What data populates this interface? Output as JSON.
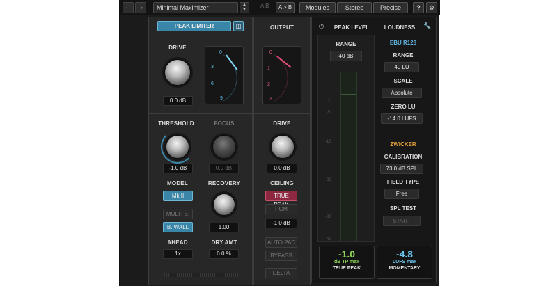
{
  "topbar": {
    "back_icon": "←",
    "forward_icon": "→",
    "preset_name": "Minimal Maximizer",
    "a_label": "A  B",
    "ab_label": "A > B",
    "modules_label": "Modules",
    "stereo_label": "Stereo",
    "precise_label": "Precise",
    "help_label": "?",
    "settings_icon": "⚙"
  },
  "limiter": {
    "header_label": "PEAK LIMITER",
    "drive_label": "DRIVE",
    "drive_value": "0.0 dB",
    "gr_scale": [
      "0",
      "3",
      "6",
      "9"
    ],
    "threshold_label": "THRESHOLD",
    "threshold_value": "-1.0 dB",
    "focus_label": "FOCUS",
    "focus_value": "0.0 dB",
    "model_label": "MODEL",
    "model_value": "Mk II",
    "recovery_label": "RECOVERY",
    "recovery_value": "1.00",
    "multi_b_label": "MULTI B.",
    "b_wall_label": "B. WALL",
    "ahead_label": "AHEAD",
    "ahead_value": "1x",
    "dry_amt_label": "DRY AMT",
    "dry_amt_value": "0.0 %"
  },
  "output": {
    "header_label": "OUTPUT",
    "scale": [
      "0",
      "1",
      "2",
      "3"
    ],
    "drive_label": "DRIVE",
    "drive_value": "0.0 dB",
    "ceiling_label": "CEILING",
    "true_peak_label": "TRUE PEAK",
    "pcm_label": "PCM",
    "ceiling_value": "-1.0 dB",
    "auto_pad_label": "AUTO PAD",
    "bypass_label": "BYPASS",
    "delta_label": "DELTA"
  },
  "meter": {
    "power_icon": "⏻",
    "peak_level_label": "PEAK LEVEL",
    "loudness_label": "LOUDNESS",
    "wrench_icon": "🔧",
    "range_label": "RANGE",
    "range_value": "40 dB",
    "ebu_label": "EBU R128",
    "loud_range_label": "RANGE",
    "loud_range_value": "40 LU",
    "scale_label": "SCALE",
    "scale_value": "Absolute",
    "zero_lu_label": "ZERO LU",
    "zero_lu_value": "-14.0 LUFS",
    "zwicker_label": "ZWICKER",
    "calibration_label": "CALIBRATION",
    "calibration_value": "73.0 dB SPL",
    "field_type_label": "FIELD TYPE",
    "field_type_value": "Free",
    "spl_test_label": "SPL TEST",
    "start_label": "START",
    "scale_marks": [
      "-1",
      "-5",
      "-10",
      "-20",
      "-30",
      "-40"
    ],
    "true_peak_value": "-1.0",
    "true_peak_unit": "dB TP max",
    "true_peak_caption": "TRUE PEAK",
    "momentary_value": "-4.8",
    "momentary_unit": "LUFS max",
    "momentary_caption": "MOMENTARY"
  },
  "colors": {
    "accent_blue": "#3a86a8",
    "accent_red": "#8e2840",
    "peak_green": "#8fd65a",
    "lufs_blue": "#6cc6f0",
    "zwicker_orange": "#e6a23a",
    "ebu_blue": "#5fb4e0"
  }
}
